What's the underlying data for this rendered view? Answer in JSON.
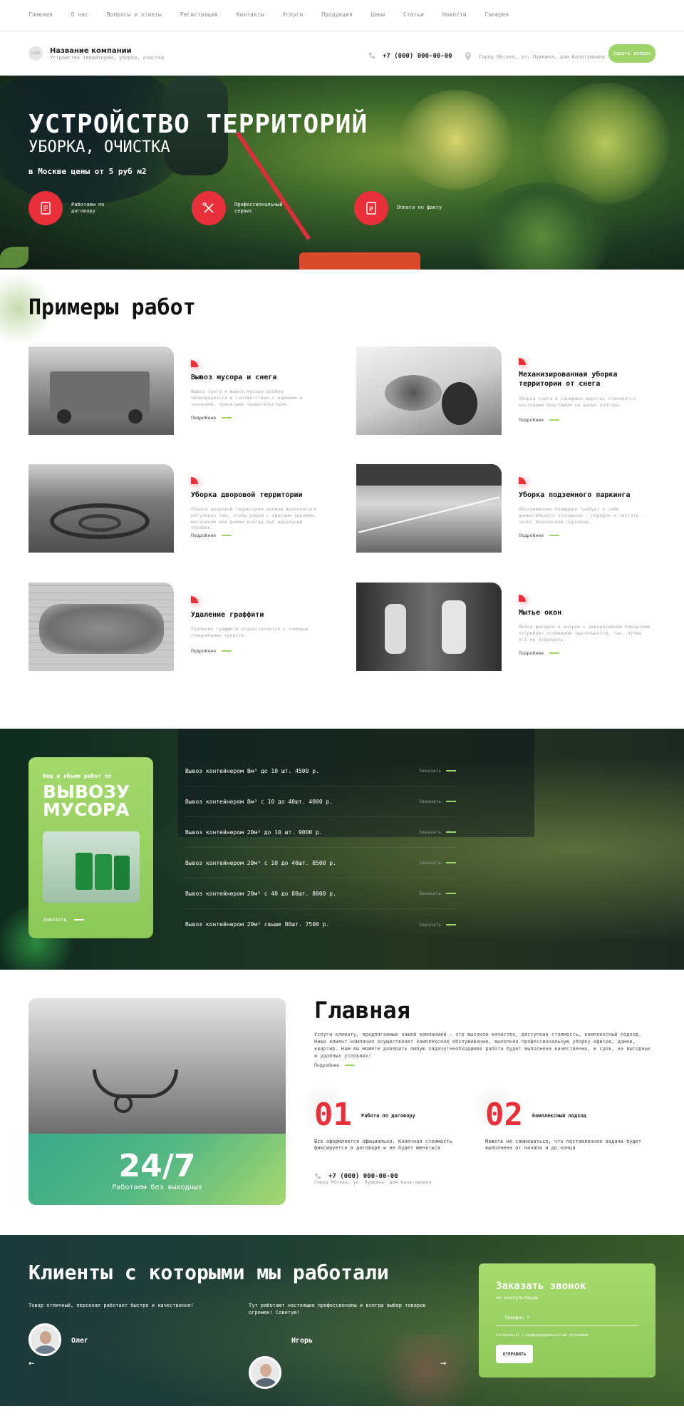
{
  "topnav": [
    "Главная",
    "О нас",
    "Вопросы и ответы",
    "Регистрация",
    "Контакты",
    "Услуги",
    "Продукция",
    "Цены",
    "Статьи",
    "Новости",
    "Галерея"
  ],
  "header": {
    "logo": "LOGO",
    "company_name": "Название компании",
    "company_sub": "Устройство территорий, уборка, очистка",
    "phone": "+7 (000) 000-00-00",
    "address": "Город Москва, ул. Пушкина, дом Калатушкина",
    "cta": "Задать вопрос"
  },
  "hero": {
    "title": "УСТРОЙСТВО ТЕРРИТОРИЙ",
    "subtitle": "УБОРКА, ОЧИСТКА",
    "price": "в Москве цены от 5 руб м2",
    "features": [
      {
        "label": "Работаем по договору",
        "icon": "document-icon"
      },
      {
        "label": "Профессиональный сервис",
        "icon": "tools-icon"
      },
      {
        "label": "Оплата по факту",
        "icon": "payment-icon"
      }
    ]
  },
  "works": {
    "title": "Примеры работ",
    "more": "Подробнее",
    "items": [
      {
        "title": "Вывоз мусора и снега",
        "desc": "Вывоз снега и вывоз мусора должен производиться в соответствии с нормами и законами, принятыми правительством."
      },
      {
        "title": "Механизированная уборка территории от снега",
        "desc": "Уборка снега в северных широтах становится настоящим бедствием на целых полгода."
      },
      {
        "title": "Уборка дворовой территории",
        "desc": "Уборка дворовой территории должна выполняться регулярно так, чтобы рядом с офисным зданием, магазином или домом всегда был идеальный порядок."
      },
      {
        "title": "Уборка подземного паркинга",
        "desc": "Обслуживание площадки требует к себе внимательного отношения - порядок и чистота - залог безопасной парковки."
      },
      {
        "title": "Удаление граффити",
        "desc": "Удаление граффити осуществляется с помощью специальных средств."
      },
      {
        "title": "Мытье окон",
        "desc": "Мойка фасадов и витрин с декоративным покрытием потребует особенной тщательности, так, чтобы его не повредить."
      }
    ]
  },
  "pricing": {
    "card_kicker": "Вид и объем работ по",
    "card_title": "ВЫВОЗУ МУСОРА",
    "card_order": "Заказать",
    "order_label": "Заказать",
    "rows": [
      "Вывоз контейнером 8м³ до 10 шт. 4500 р.",
      "Вывоз контейнером 8м³ с 10 до 40шт. 4000 р.",
      "Вывоз контейнером 20м³ до 10 шт. 9000 р.",
      "Вывоз контейнером 20м³ с 10 до 40шт. 8500 р.",
      "Вывоз контейнером 20м³ с 40 до 80шт. 8000 р.",
      "Вывоз контейнером 20м³ свыше 80шт. 7500 р."
    ]
  },
  "about": {
    "title": "Главная",
    "text": "Услуги клиенту, предлагаемые нашей компанией — это высокое качество, доступная стоимость, комплексный подход. Наша клиент компания осуществляет комплексное обслуживание, выполняя профессиональную уборку офисов, домов, квартир. Нам вы можете доверить любую задачу!необходимая работа будет выполнена качественно, в срок, на выгодных и удобных условиях!",
    "more": "Подробнее",
    "badge_big": "24/7",
    "badge_small": "Работаем без выходных",
    "points": [
      {
        "num": "01",
        "label": "Работа по договору",
        "desc": "Все оформляется официально. Конечная стоимость фиксируется в договоре и не будет меняться"
      },
      {
        "num": "02",
        "label": "Комплексный подход",
        "desc": "Можете не сомневаться, что поставленная задача будет выполнена от начала и до конца"
      }
    ],
    "phone": "+7 (000) 000-00-00",
    "address": "Город Москва, ул. Пушкина, дом Калатушкина"
  },
  "clients": {
    "title": "Клиенты с которыми мы работали",
    "reviews": [
      {
        "text": "Товар отличный, персонал работает быстро и качественно!",
        "name": "Олег"
      },
      {
        "text": "Тут работают настоящие профессионалы и всегда выбор товаров огромен! Советую!",
        "name": "Игорь"
      }
    ],
    "prev": "←",
    "next": "→",
    "callback": {
      "title": "Заказать звонок",
      "sub": "на консультацию",
      "phone_placeholder": "Телефон *",
      "consent": "Согласен(а) с конфиденциальностью условиями",
      "submit": "ОТПРАВИТЬ"
    }
  },
  "colors": {
    "accent_red": "#e8303a",
    "accent_green": "#9fd46a"
  }
}
